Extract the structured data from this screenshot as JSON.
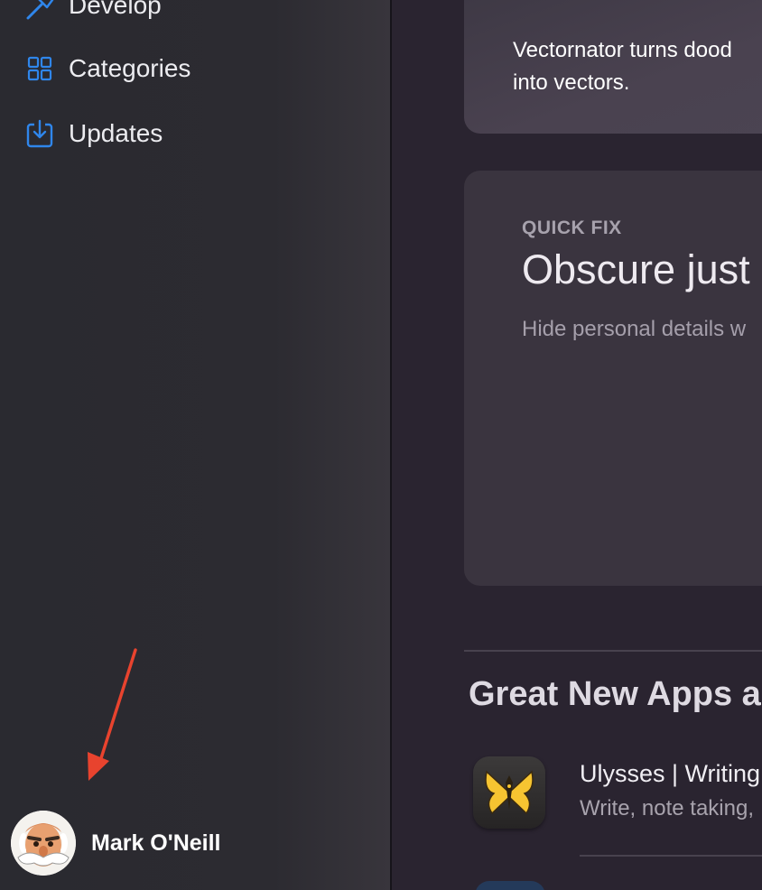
{
  "sidebar": {
    "items": [
      {
        "label": "Develop",
        "icon": "hammer-icon"
      },
      {
        "label": "Categories",
        "icon": "grid-icon"
      },
      {
        "label": "Updates",
        "icon": "download-icon"
      }
    ],
    "user": {
      "name": "Mark O'Neill",
      "icon": "avatar"
    }
  },
  "main": {
    "top_card": {
      "line1": "Vectornator turns dood",
      "line2": "into vectors."
    },
    "quick_fix": {
      "eyebrow": "QUICK FIX",
      "title": "Obscure just",
      "subtitle": "Hide personal details w"
    },
    "section_title": "Great New Apps ar",
    "apps": [
      {
        "name": "Ulysses | Writing",
        "desc": "Write, note taking,",
        "icon": "butterfly-icon"
      }
    ]
  },
  "colors": {
    "accent": "#2f86eb",
    "annotation_arrow": "#e8432e"
  }
}
